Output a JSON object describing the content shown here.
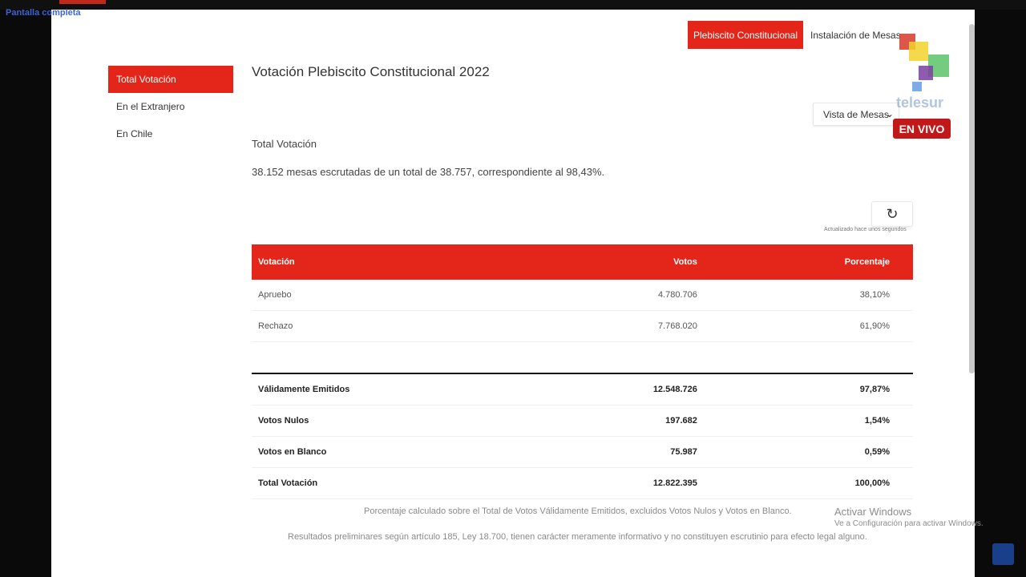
{
  "overlay": {
    "fullscreen_label": "Pantalla completa"
  },
  "topnav": {
    "plebiscito": "Plebiscito Constitucional",
    "instalacion": "Instalación de Mesas"
  },
  "sidebar": {
    "items": [
      {
        "label": "Total Votación",
        "active": true
      },
      {
        "label": "En el Extranjero",
        "active": false
      },
      {
        "label": "En Chile",
        "active": false
      }
    ]
  },
  "main": {
    "title": "Votación Plebiscito Constitucional 2022",
    "view_select": "Vista de Mesas",
    "section_title": "Total Votación",
    "summary": "38.152 mesas escrutadas de un total de 38.757, correspondiente al 98,43%.",
    "updated_note": "Actualizado hace unos segundos"
  },
  "table": {
    "headers": {
      "votacion": "Votación",
      "votos": "Votos",
      "porcentaje": "Porcentaje"
    },
    "rows": [
      {
        "label": "Apruebo",
        "votos": "4.780.706",
        "pct": "38,10%"
      },
      {
        "label": "Rechazo",
        "votos": "7.768.020",
        "pct": "61,90%"
      }
    ],
    "totals": [
      {
        "label": "Válidamente Emitidos",
        "votos": "12.548.726",
        "pct": "97,87%"
      },
      {
        "label": "Votos Nulos",
        "votos": "197.682",
        "pct": "1,54%"
      },
      {
        "label": "Votos en Blanco",
        "votos": "75.987",
        "pct": "0,59%"
      },
      {
        "label": "Total Votación",
        "votos": "12.822.395",
        "pct": "100,00%"
      }
    ]
  },
  "footnotes": {
    "note1": "Porcentaje calculado sobre el Total de Votos Válidamente Emitidos, excluidos Votos Nulos y Votos en Blanco.",
    "note2": "Resultados preliminares según artículo 185, Ley 18.700, tienen carácter meramente informativo y no constituyen escrutinio para efecto legal alguno."
  },
  "broadcast": {
    "brand": "telesur",
    "live": "EN VIVO"
  },
  "windows": {
    "activate_title": "Activar Windows",
    "activate_sub": "Ve a Configuración para activar Windows."
  },
  "colors": {
    "accent": "#e32619"
  }
}
